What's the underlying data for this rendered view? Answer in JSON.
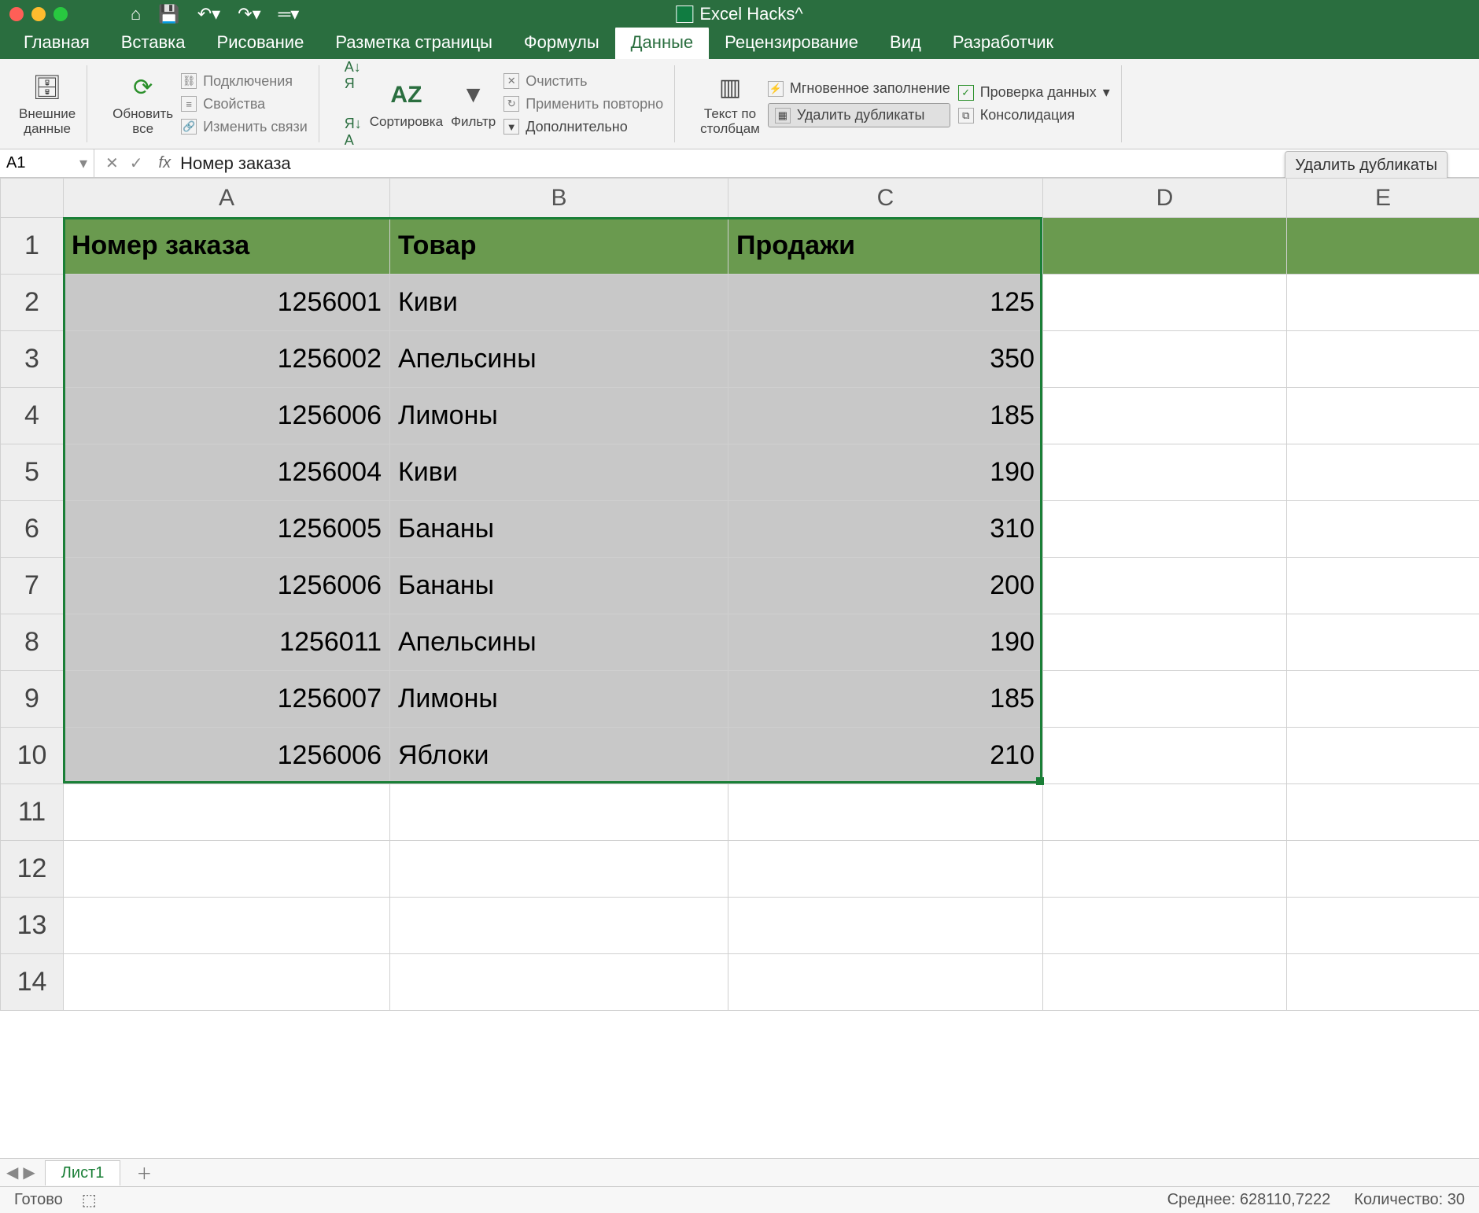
{
  "title": "Excel Hacks^",
  "menu": {
    "tabs": [
      "Главная",
      "Вставка",
      "Рисование",
      "Разметка страницы",
      "Формулы",
      "Данные",
      "Рецензирование",
      "Вид",
      "Разработчик"
    ],
    "active": "Данные"
  },
  "ribbon": {
    "external_data": "Внешние\nданные",
    "refresh_all": "Обновить\nвсе",
    "connections": "Подключения",
    "properties": "Свойства",
    "edit_links": "Изменить связи",
    "sort": "Сортировка",
    "filter": "Фильтр",
    "clear": "Очистить",
    "reapply": "Применить повторно",
    "advanced": "Дополнительно",
    "text_to_cols": "Текст по\nстолбцам",
    "flash_fill": "Мгновенное заполнение",
    "remove_dup": "Удалить дубликаты",
    "data_val": "Проверка данных",
    "consolidate": "Консолидация"
  },
  "tooltip": "Удалить дубликаты",
  "fx": {
    "cell": "A1",
    "value": "Номер заказа"
  },
  "columns": [
    "A",
    "B",
    "C",
    "D",
    "E"
  ],
  "headers": [
    "Номер заказа",
    "Товар",
    "Продажи"
  ],
  "rows": [
    {
      "n": "2",
      "order": "1256001",
      "item": "Киви",
      "sales": "125"
    },
    {
      "n": "3",
      "order": "1256002",
      "item": "Апельсины",
      "sales": "350"
    },
    {
      "n": "4",
      "order": "1256006",
      "item": "Лимоны",
      "sales": "185"
    },
    {
      "n": "5",
      "order": "1256004",
      "item": "Киви",
      "sales": "190"
    },
    {
      "n": "6",
      "order": "1256005",
      "item": "Бананы",
      "sales": "310"
    },
    {
      "n": "7",
      "order": "1256006",
      "item": "Бананы",
      "sales": "200"
    },
    {
      "n": "8",
      "order": "1256011",
      "item": "Апельсины",
      "sales": "190"
    },
    {
      "n": "9",
      "order": "1256007",
      "item": "Лимоны",
      "sales": "185"
    },
    {
      "n": "10",
      "order": "1256006",
      "item": "Яблоки",
      "sales": "210"
    }
  ],
  "empty_rows": [
    "11",
    "12",
    "13",
    "14"
  ],
  "sheet_tab": "Лист1",
  "status": {
    "ready": "Готово",
    "avg": "Среднее: 628110,7222",
    "count": "Количество: 30"
  }
}
